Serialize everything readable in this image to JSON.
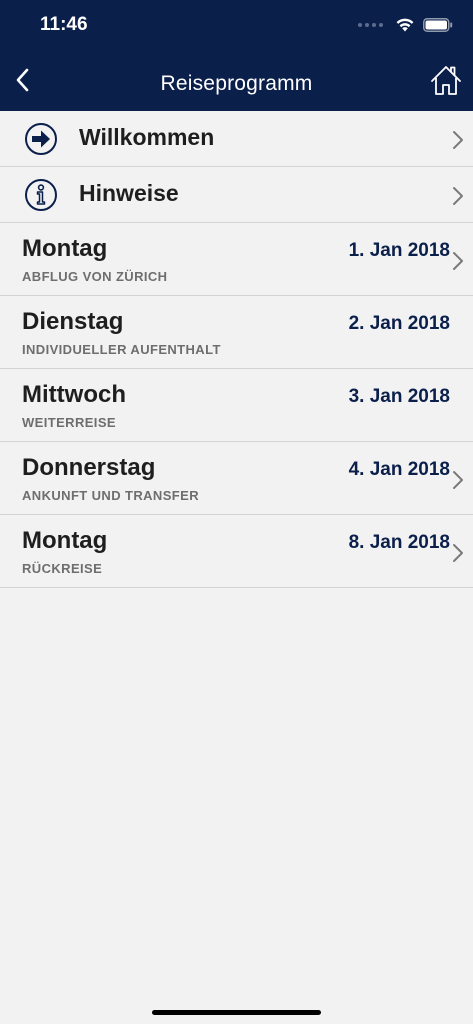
{
  "status_bar": {
    "time": "11:46"
  },
  "nav": {
    "title": "Reiseprogramm",
    "back_icon": "chevron-left-icon",
    "home_icon": "home-icon"
  },
  "colors": {
    "header_bg": "#0b1f4b",
    "accent": "#0b1f4b",
    "background": "#f2f2f2"
  },
  "menu": [
    {
      "label": "Willkommen",
      "icon": "arrow-right-circle-icon"
    },
    {
      "label": "Hinweise",
      "icon": "info-circle-icon"
    }
  ],
  "days": [
    {
      "weekday": "Montag",
      "date": "1. Jan 2018",
      "subtitle": "ABFLUG VON ZÜRICH",
      "has_chevron": true
    },
    {
      "weekday": "Dienstag",
      "date": "2. Jan 2018",
      "subtitle": "INDIVIDUELLER AUFENTHALT",
      "has_chevron": false
    },
    {
      "weekday": "Mittwoch",
      "date": "3. Jan 2018",
      "subtitle": "WEITERREISE",
      "has_chevron": false
    },
    {
      "weekday": "Donnerstag",
      "date": "4. Jan 2018",
      "subtitle": "ANKUNFT UND TRANSFER",
      "has_chevron": true
    },
    {
      "weekday": "Montag",
      "date": "8. Jan 2018",
      "subtitle": "RÜCKREISE",
      "has_chevron": true
    }
  ]
}
